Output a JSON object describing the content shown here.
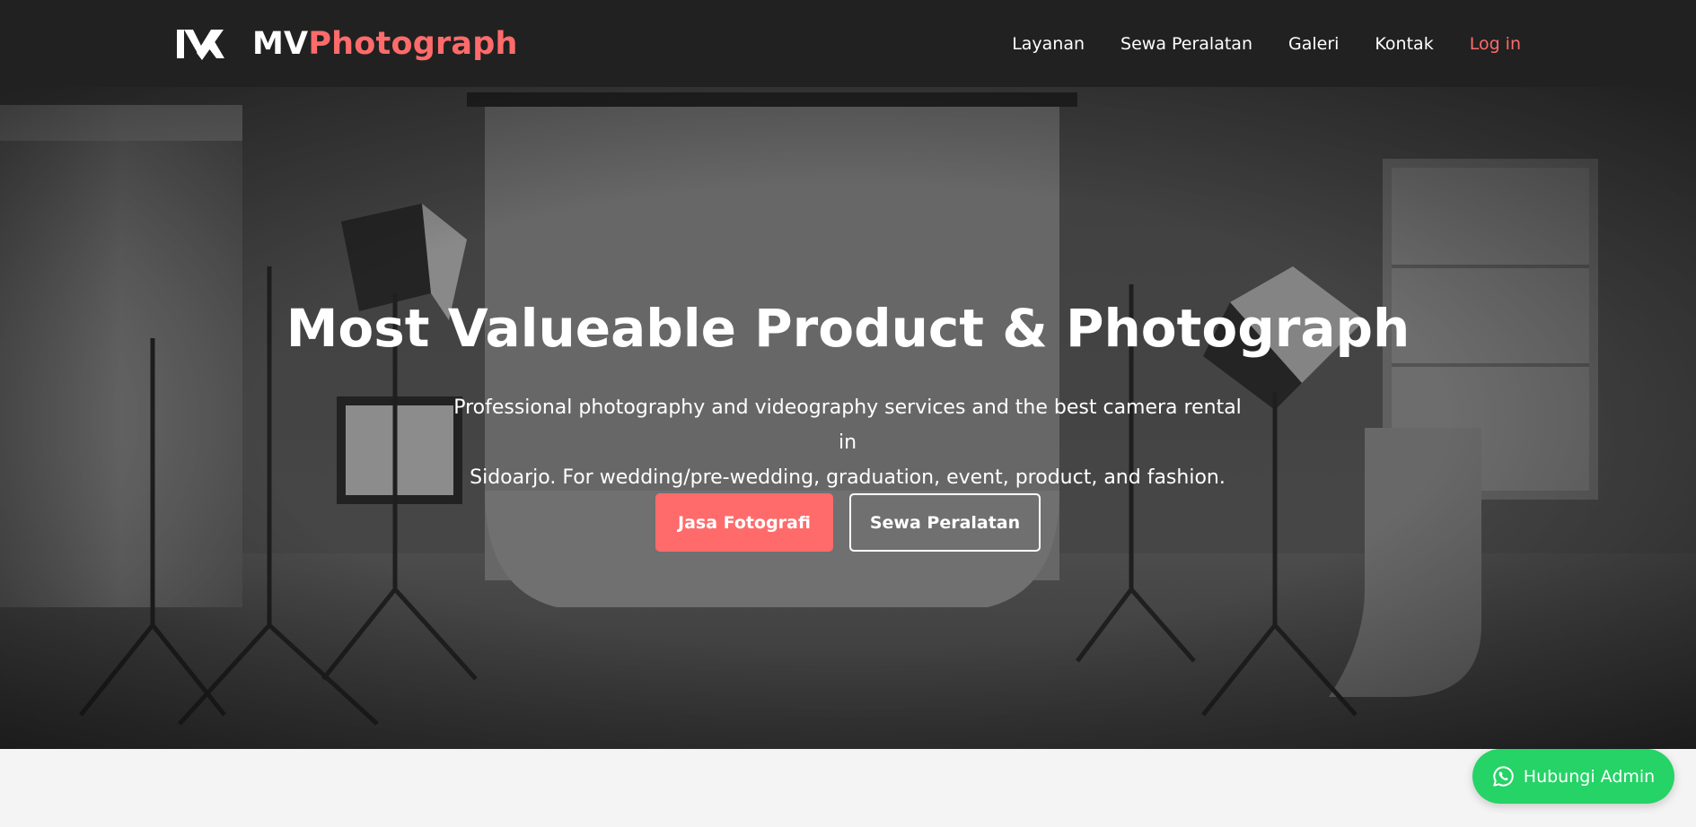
{
  "brand": {
    "logo_icon": "mv-monogram-logo",
    "name_part1": "MV",
    "name_part2": "Photograph"
  },
  "nav": {
    "items": [
      {
        "label": "Layanan"
      },
      {
        "label": "Sewa Peralatan"
      },
      {
        "label": "Galeri"
      },
      {
        "label": "Kontak"
      }
    ],
    "login_label": "Log in"
  },
  "hero": {
    "title": "Most Valueable Product & Photograph",
    "description_line1": "Professional photography and videography services and the best camera rental in",
    "description_line2": "Sidoarjo. For wedding/pre-wedding, graduation, event, product, and fashion.",
    "primary_button": "Jasa Fotografi",
    "secondary_button": "Sewa Peralatan"
  },
  "whatsapp": {
    "icon": "whatsapp-icon",
    "label": "Hubungi Admin"
  },
  "colors": {
    "accent": "#ff6b6b",
    "navbar": "#212121",
    "whatsapp": "#25d366"
  }
}
